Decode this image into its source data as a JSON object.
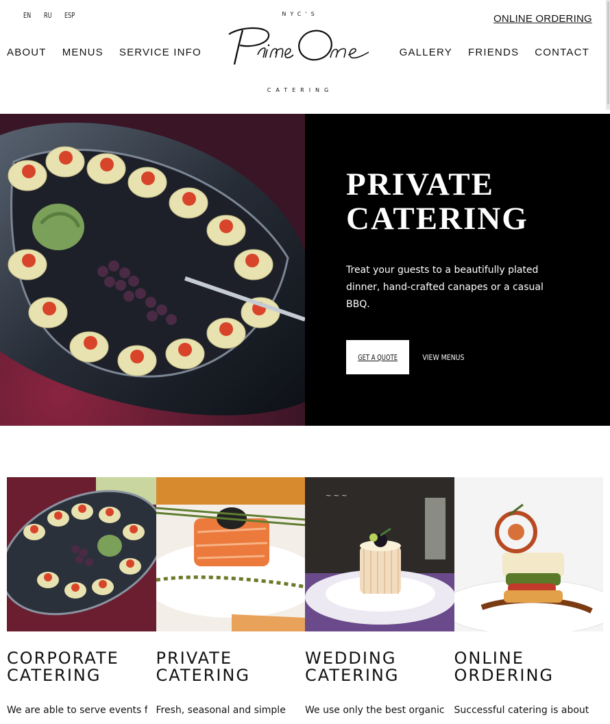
{
  "header": {
    "languages": [
      "EN",
      "RU",
      "ESP"
    ],
    "online_ordering": "ONLINE ORDERING",
    "nav_left": [
      "ABOUT",
      "MENUS",
      "SERVICE INFO"
    ],
    "nav_right": [
      "GALLERY",
      "FRIENDS",
      "CONTACT"
    ],
    "logo": {
      "top_text": "NYC'S",
      "script_text": "Prime One",
      "bottom_text": "CATERING"
    }
  },
  "hero": {
    "title_line1": "PRIVATE",
    "title_line2": "CATERING",
    "description": "Treat your guests to a beautifully plated dinner, hand-crafted canapes or a casual BBQ.",
    "quote_button": "GET A QUOTE",
    "menus_link": "VIEW MENUS"
  },
  "cards": [
    {
      "title_line1": "CORPORATE",
      "title_line2": "CATERING",
      "text": "We are able to serve events from"
    },
    {
      "title_line1": "PRIVATE",
      "title_line2": "CATERING",
      "text": "Fresh, seasonal and simple"
    },
    {
      "title_line1": "WEDDING",
      "title_line2": "CATERING",
      "text": "We use only the best organic"
    },
    {
      "title_line1": "ONLINE",
      "title_line2": "ORDERING",
      "text": "Successful catering is about"
    }
  ]
}
